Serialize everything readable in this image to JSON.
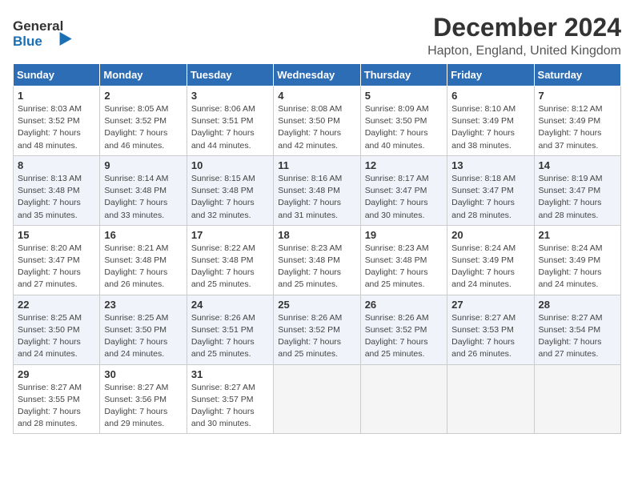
{
  "header": {
    "logo_line1": "General",
    "logo_line2": "Blue",
    "main_title": "December 2024",
    "subtitle": "Hapton, England, United Kingdom"
  },
  "calendar": {
    "days_of_week": [
      "Sunday",
      "Monday",
      "Tuesday",
      "Wednesday",
      "Thursday",
      "Friday",
      "Saturday"
    ],
    "weeks": [
      [
        {
          "day": "1",
          "info": "Sunrise: 8:03 AM\nSunset: 3:52 PM\nDaylight: 7 hours\nand 48 minutes."
        },
        {
          "day": "2",
          "info": "Sunrise: 8:05 AM\nSunset: 3:52 PM\nDaylight: 7 hours\nand 46 minutes."
        },
        {
          "day": "3",
          "info": "Sunrise: 8:06 AM\nSunset: 3:51 PM\nDaylight: 7 hours\nand 44 minutes."
        },
        {
          "day": "4",
          "info": "Sunrise: 8:08 AM\nSunset: 3:50 PM\nDaylight: 7 hours\nand 42 minutes."
        },
        {
          "day": "5",
          "info": "Sunrise: 8:09 AM\nSunset: 3:50 PM\nDaylight: 7 hours\nand 40 minutes."
        },
        {
          "day": "6",
          "info": "Sunrise: 8:10 AM\nSunset: 3:49 PM\nDaylight: 7 hours\nand 38 minutes."
        },
        {
          "day": "7",
          "info": "Sunrise: 8:12 AM\nSunset: 3:49 PM\nDaylight: 7 hours\nand 37 minutes."
        }
      ],
      [
        {
          "day": "8",
          "info": "Sunrise: 8:13 AM\nSunset: 3:48 PM\nDaylight: 7 hours\nand 35 minutes."
        },
        {
          "day": "9",
          "info": "Sunrise: 8:14 AM\nSunset: 3:48 PM\nDaylight: 7 hours\nand 33 minutes."
        },
        {
          "day": "10",
          "info": "Sunrise: 8:15 AM\nSunset: 3:48 PM\nDaylight: 7 hours\nand 32 minutes."
        },
        {
          "day": "11",
          "info": "Sunrise: 8:16 AM\nSunset: 3:48 PM\nDaylight: 7 hours\nand 31 minutes."
        },
        {
          "day": "12",
          "info": "Sunrise: 8:17 AM\nSunset: 3:47 PM\nDaylight: 7 hours\nand 30 minutes."
        },
        {
          "day": "13",
          "info": "Sunrise: 8:18 AM\nSunset: 3:47 PM\nDaylight: 7 hours\nand 28 minutes."
        },
        {
          "day": "14",
          "info": "Sunrise: 8:19 AM\nSunset: 3:47 PM\nDaylight: 7 hours\nand 28 minutes."
        }
      ],
      [
        {
          "day": "15",
          "info": "Sunrise: 8:20 AM\nSunset: 3:47 PM\nDaylight: 7 hours\nand 27 minutes."
        },
        {
          "day": "16",
          "info": "Sunrise: 8:21 AM\nSunset: 3:48 PM\nDaylight: 7 hours\nand 26 minutes."
        },
        {
          "day": "17",
          "info": "Sunrise: 8:22 AM\nSunset: 3:48 PM\nDaylight: 7 hours\nand 25 minutes."
        },
        {
          "day": "18",
          "info": "Sunrise: 8:23 AM\nSunset: 3:48 PM\nDaylight: 7 hours\nand 25 minutes."
        },
        {
          "day": "19",
          "info": "Sunrise: 8:23 AM\nSunset: 3:48 PM\nDaylight: 7 hours\nand 25 minutes."
        },
        {
          "day": "20",
          "info": "Sunrise: 8:24 AM\nSunset: 3:49 PM\nDaylight: 7 hours\nand 24 minutes."
        },
        {
          "day": "21",
          "info": "Sunrise: 8:24 AM\nSunset: 3:49 PM\nDaylight: 7 hours\nand 24 minutes."
        }
      ],
      [
        {
          "day": "22",
          "info": "Sunrise: 8:25 AM\nSunset: 3:50 PM\nDaylight: 7 hours\nand 24 minutes."
        },
        {
          "day": "23",
          "info": "Sunrise: 8:25 AM\nSunset: 3:50 PM\nDaylight: 7 hours\nand 24 minutes."
        },
        {
          "day": "24",
          "info": "Sunrise: 8:26 AM\nSunset: 3:51 PM\nDaylight: 7 hours\nand 25 minutes."
        },
        {
          "day": "25",
          "info": "Sunrise: 8:26 AM\nSunset: 3:52 PM\nDaylight: 7 hours\nand 25 minutes."
        },
        {
          "day": "26",
          "info": "Sunrise: 8:26 AM\nSunset: 3:52 PM\nDaylight: 7 hours\nand 25 minutes."
        },
        {
          "day": "27",
          "info": "Sunrise: 8:27 AM\nSunset: 3:53 PM\nDaylight: 7 hours\nand 26 minutes."
        },
        {
          "day": "28",
          "info": "Sunrise: 8:27 AM\nSunset: 3:54 PM\nDaylight: 7 hours\nand 27 minutes."
        }
      ],
      [
        {
          "day": "29",
          "info": "Sunrise: 8:27 AM\nSunset: 3:55 PM\nDaylight: 7 hours\nand 28 minutes."
        },
        {
          "day": "30",
          "info": "Sunrise: 8:27 AM\nSunset: 3:56 PM\nDaylight: 7 hours\nand 29 minutes."
        },
        {
          "day": "31",
          "info": "Sunrise: 8:27 AM\nSunset: 3:57 PM\nDaylight: 7 hours\nand 30 minutes."
        },
        {
          "day": "",
          "info": ""
        },
        {
          "day": "",
          "info": ""
        },
        {
          "day": "",
          "info": ""
        },
        {
          "day": "",
          "info": ""
        }
      ]
    ]
  }
}
